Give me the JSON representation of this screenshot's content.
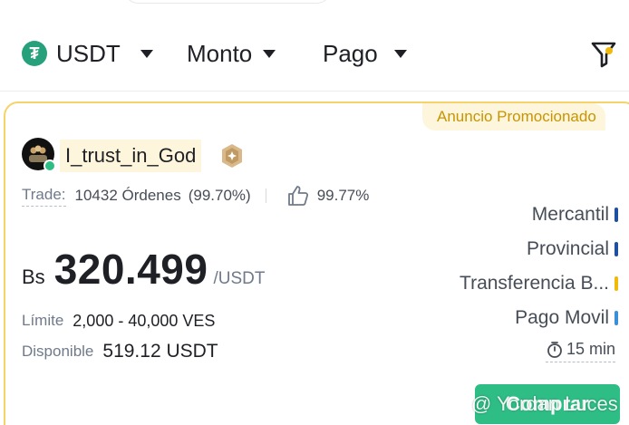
{
  "filters": {
    "asset": "USDT",
    "amount": "Monto",
    "payment": "Pago"
  },
  "ad": {
    "promo_badge": "Anuncio Promocionado",
    "merchant_name": "I_trust_in_God",
    "trade_label": "Trade:",
    "orders": "10432 Órdenes",
    "completion": "(99.70%)",
    "positive_rate": "99.77%",
    "currency_symbol": "Bs",
    "price": "320.499",
    "price_unit": "/USDT",
    "limit_label": "Límite",
    "limit_value": "2,000 - 40,000 VES",
    "available_label": "Disponible",
    "available_value": "519.12 USDT",
    "payment_methods": [
      {
        "name": "Mercantil",
        "color": "#1e4fa0"
      },
      {
        "name": "Provincial",
        "color": "#1e4fa0"
      },
      {
        "name": "Transferencia B...",
        "color": "#f0b90b"
      },
      {
        "name": "Pago Movil",
        "color": "#3b8fd9"
      }
    ],
    "time_limit": "15 min",
    "buy_label": "Comprar"
  },
  "watermark": "@ Yordan Luces",
  "colors": {
    "accent": "#f0b90b",
    "buy_green": "#2ebd85",
    "tether": "#26a17b"
  }
}
